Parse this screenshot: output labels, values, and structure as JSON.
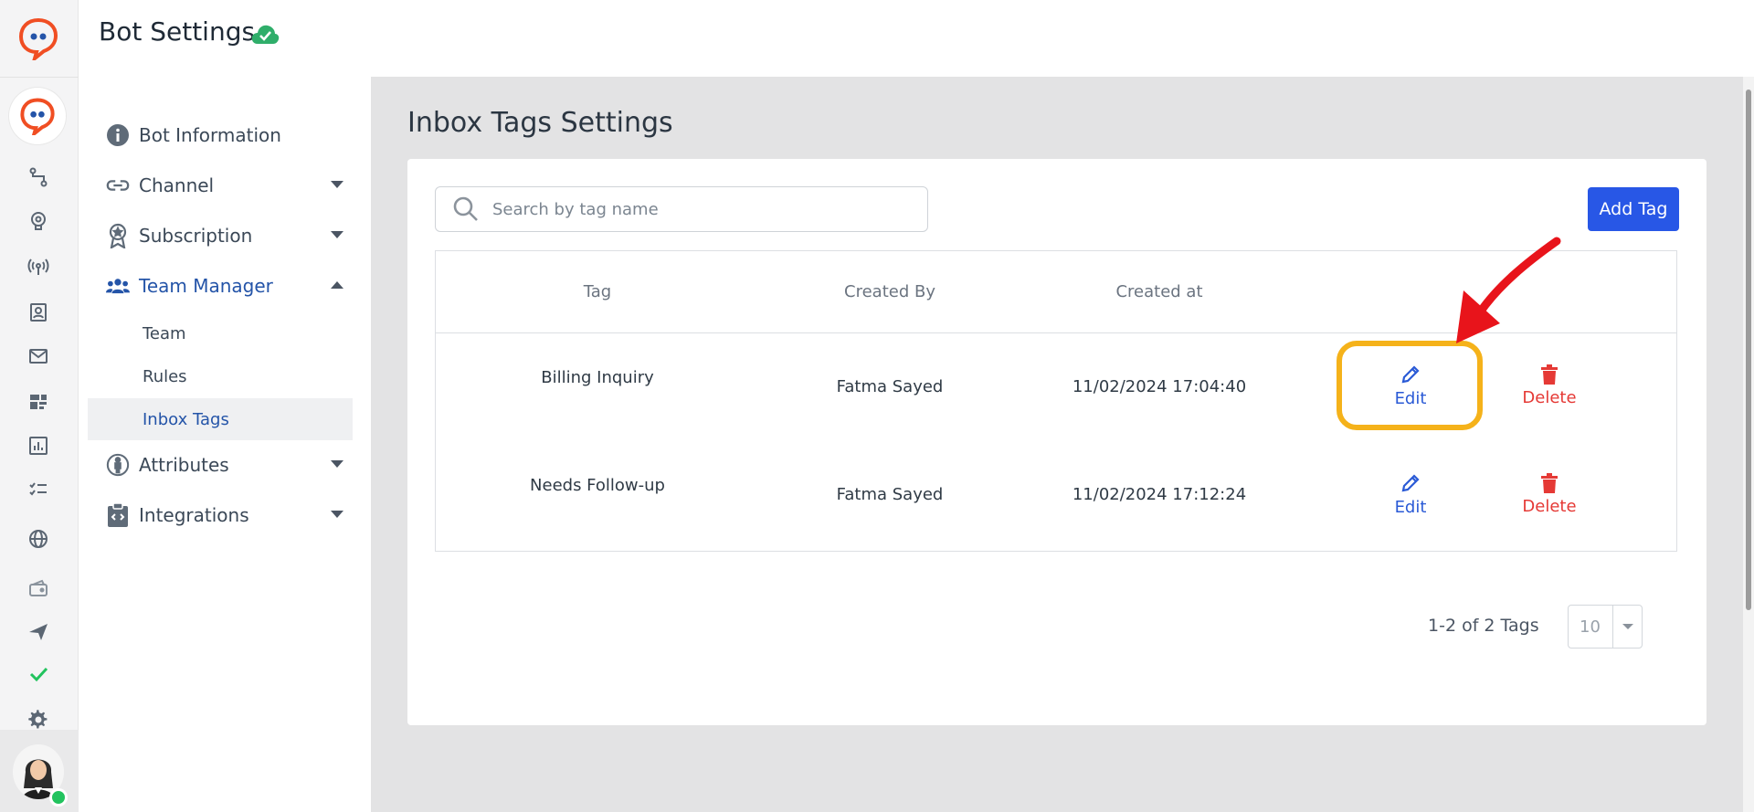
{
  "header": {
    "title": "Bot Settings",
    "status_icon": "cloud-check-icon"
  },
  "rail": {
    "icons": [
      "flow-icon",
      "brain-icon",
      "broadcast-icon",
      "contacts-icon",
      "mail-icon",
      "dashboard-icon",
      "analytics-icon",
      "tasks-icon",
      "globe-icon",
      "wallet-icon",
      "send-icon",
      "check-icon",
      "gear-icon"
    ],
    "accent": "#f04e23"
  },
  "sidebar": {
    "items": [
      {
        "label": "Bot Information",
        "icon": "info-icon"
      },
      {
        "label": "Channel",
        "icon": "link-icon"
      },
      {
        "label": "Subscription",
        "icon": "award-icon"
      },
      {
        "label": "Team Manager",
        "icon": "users-icon"
      },
      {
        "label": "Attributes",
        "icon": "person-icon"
      },
      {
        "label": "Integrations",
        "icon": "code-clipboard-icon"
      }
    ],
    "team_sub": [
      "Team",
      "Rules",
      "Inbox Tags"
    ]
  },
  "main": {
    "title": "Inbox Tags Settings",
    "search_placeholder": "Search by tag name",
    "add_button": "Add Tag",
    "columns": [
      "Tag",
      "Created By",
      "Created at"
    ],
    "rows": [
      {
        "tag": "Billing Inquiry",
        "created_by": "Fatma Sayed",
        "created_at": "11/02/2024 17:04:40",
        "edit": "Edit",
        "delete": "Delete"
      },
      {
        "tag": "Needs Follow-up",
        "created_by": "Fatma Sayed",
        "created_at": "11/02/2024 17:12:24",
        "edit": "Edit",
        "delete": "Delete"
      }
    ],
    "pagination": {
      "summary": "1-2 of 2 Tags",
      "page_size": "10"
    }
  },
  "colors": {
    "primary_button": "#2857e6",
    "edit": "#2a5ad6",
    "delete": "#e53935",
    "highlight": "#f5b21a",
    "arrow": "#e8141b"
  }
}
